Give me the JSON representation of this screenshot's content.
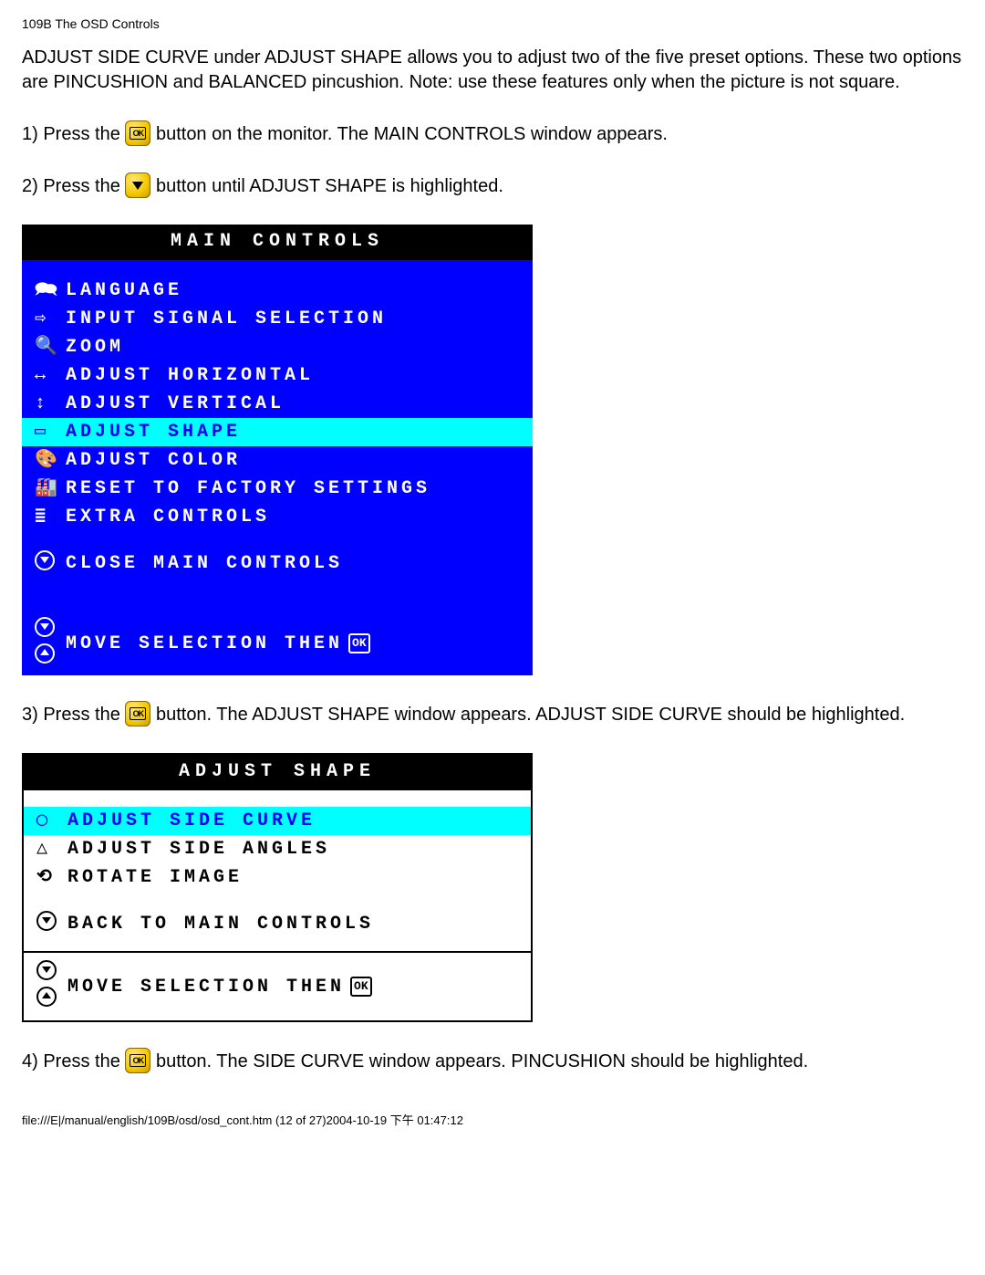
{
  "header": "109B The OSD Controls",
  "intro": "ADJUST SIDE CURVE under ADJUST SHAPE allows you to adjust two of the five preset options. These two options are PINCUSHION and BALANCED pincushion. Note: use these features only when the picture is not square.",
  "steps": {
    "s1a": "1) Press the ",
    "s1b": " button on the monitor. The MAIN CONTROLS window appears.",
    "s2a": "2) Press the ",
    "s2b": " button until ADJUST SHAPE is highlighted.",
    "s3a": "3) Press the ",
    "s3b": " button. The ADJUST SHAPE window appears. ADJUST SIDE CURVE should be highlighted.",
    "s4a": "4) Press the ",
    "s4b": " button. The SIDE CURVE window appears. PINCUSHION should be highlighted."
  },
  "osd_main": {
    "title": "MAIN CONTROLS",
    "items": [
      {
        "icon": "🗪",
        "label": "LANGUAGE",
        "hl": false
      },
      {
        "icon": "⇨",
        "label": "INPUT SIGNAL SELECTION",
        "hl": false
      },
      {
        "icon": "🔍",
        "label": "ZOOM",
        "hl": false
      },
      {
        "icon": "↔",
        "label": "ADJUST HORIZONTAL",
        "hl": false
      },
      {
        "icon": "↕",
        "label": "ADJUST VERTICAL",
        "hl": false
      },
      {
        "icon": "▭",
        "label": "ADJUST SHAPE",
        "hl": true
      },
      {
        "icon": "🎨",
        "label": "ADJUST COLOR",
        "hl": false
      },
      {
        "icon": "🏭",
        "label": "RESET TO FACTORY SETTINGS",
        "hl": false
      },
      {
        "icon": "≣",
        "label": "EXTRA CONTROLS",
        "hl": false
      }
    ],
    "close": "CLOSE MAIN CONTROLS",
    "footer": "MOVE SELECTION THEN",
    "footer_ok": "OK"
  },
  "osd_shape": {
    "title": "ADJUST SHAPE",
    "items": [
      {
        "icon": "◯",
        "label": "ADJUST SIDE CURVE",
        "hl": true
      },
      {
        "icon": "△",
        "label": "ADJUST SIDE ANGLES",
        "hl": false
      },
      {
        "icon": "⟲",
        "label": "ROTATE IMAGE",
        "hl": false
      }
    ],
    "back": "BACK TO MAIN CONTROLS",
    "footer": "MOVE SELECTION THEN",
    "footer_ok": "OK"
  },
  "page_footer": "file:///E|/manual/english/109B/osd/osd_cont.htm (12 of 27)2004-10-19 下午 01:47:12"
}
